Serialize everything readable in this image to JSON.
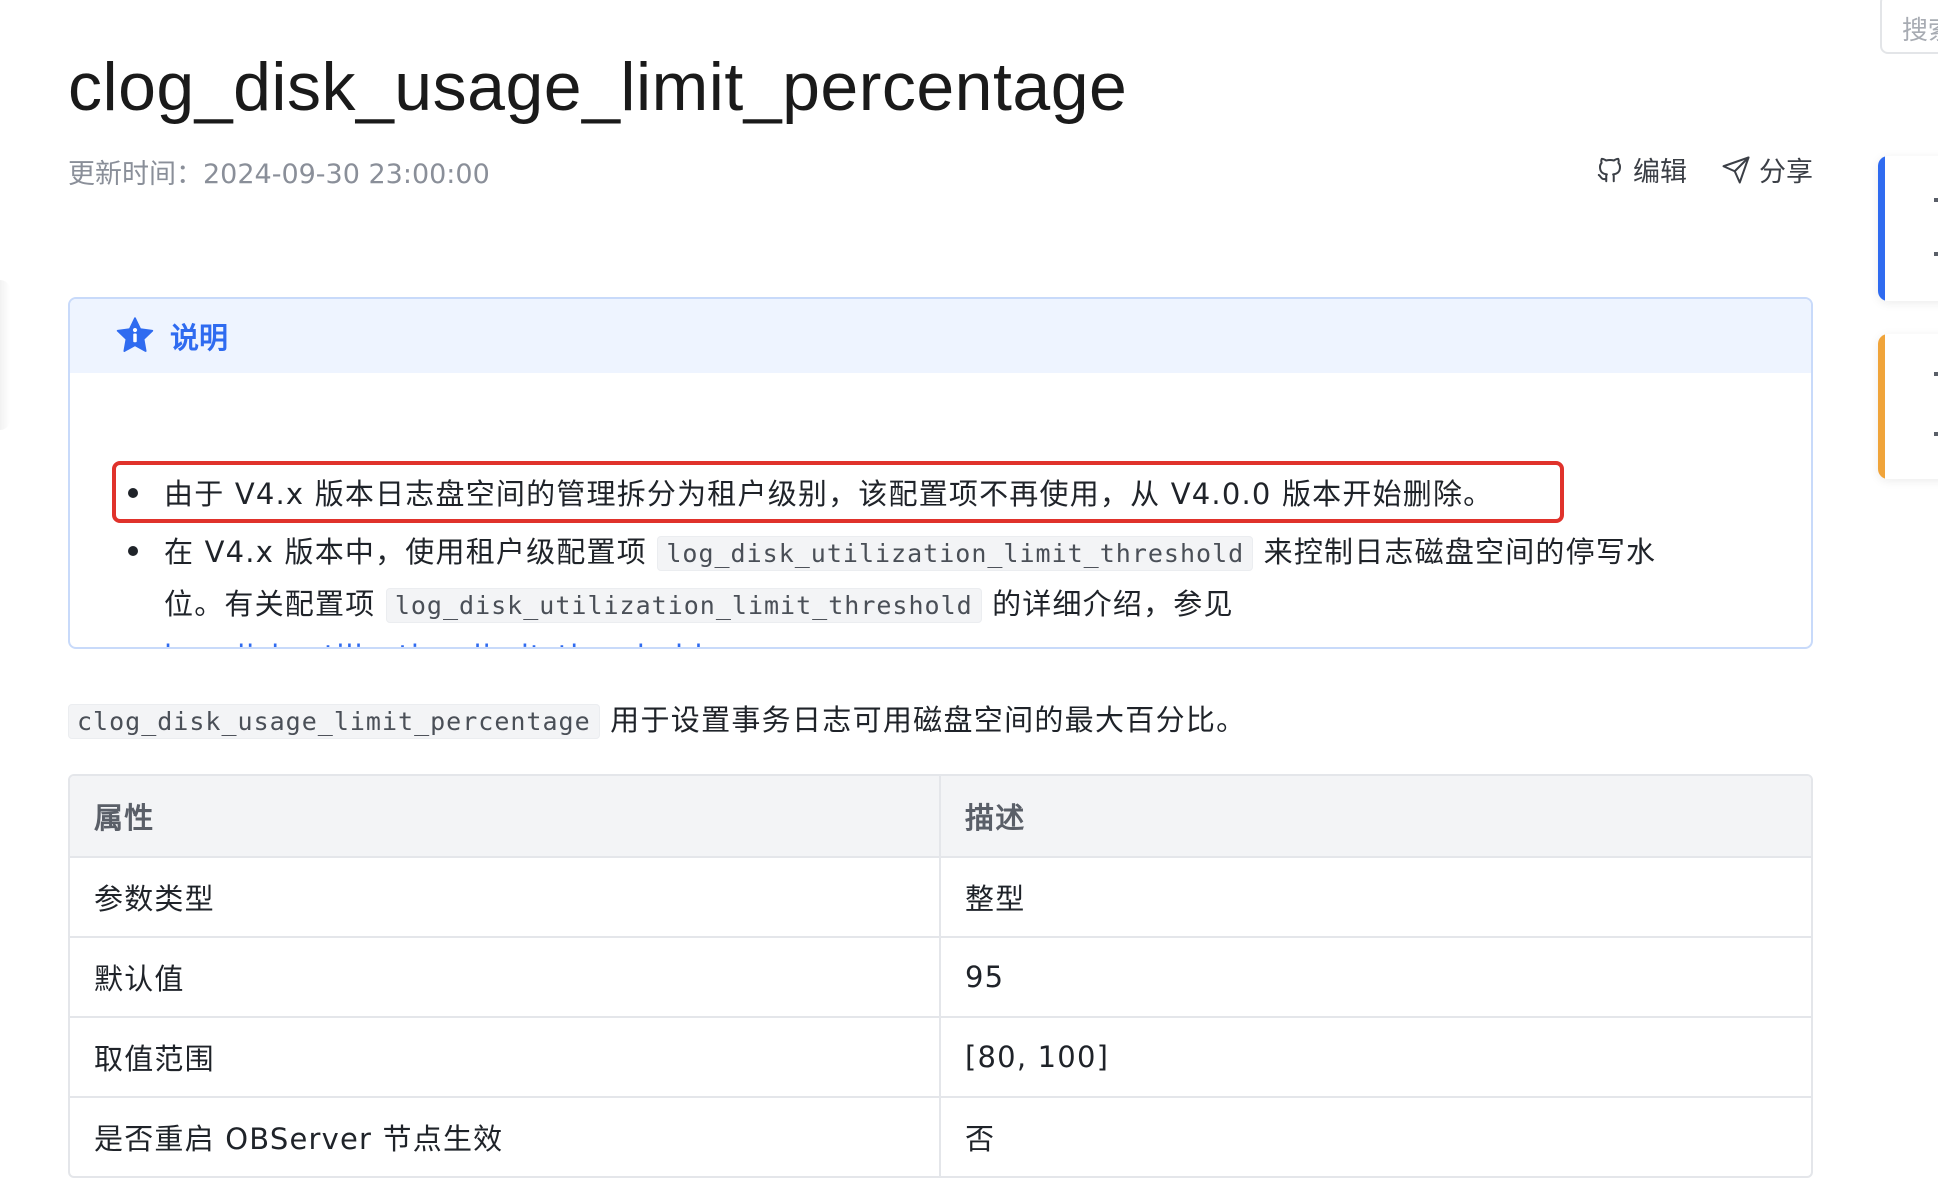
{
  "page": {
    "title": "clog_disk_usage_limit_percentage",
    "updated_label": "更新时间：",
    "updated_value": "2024-09-30 23:00:00"
  },
  "actions": {
    "edit_label": "编辑",
    "share_label": "分享"
  },
  "note": {
    "heading": "说明",
    "item1": "由于 V4.x 版本日志盘空间的管理拆分为租户级别，该配置项不再使用，从 V4.0.0 版本开始删除。",
    "item2_part1": "在 V4.x 版本中，使用租户级配置项",
    "item2_code1": "log_disk_utilization_limit_threshold",
    "item2_part2": "来控制日志磁盘空间的停写水",
    "item2_part3": "位。有关配置项",
    "item2_code2": "log_disk_utilization_limit_threshold",
    "item2_part4": "的详细介绍，参见",
    "item2_link": "log_disk_utilization_limit_threshold",
    "item2_end": "。"
  },
  "description": {
    "code": "clog_disk_usage_limit_percentage",
    "text": "用于设置事务日志可用磁盘空间的最大百分比。"
  },
  "table": {
    "headers": [
      "属性",
      "描述"
    ],
    "rows": [
      [
        "参数类型",
        "整型"
      ],
      [
        "默认值",
        "95"
      ],
      [
        "取值范围",
        "[80, 100]"
      ],
      [
        "是否重启 OBServer 节点生效",
        "否"
      ]
    ]
  },
  "rail": {
    "search_placeholder": "搜索",
    "card_colors": [
      "#2f6bf0",
      "#f0a43a"
    ]
  },
  "colors": {
    "accent": "#2f6bf0",
    "highlight": "#e0322b",
    "note_bg": "#eef4ff"
  }
}
